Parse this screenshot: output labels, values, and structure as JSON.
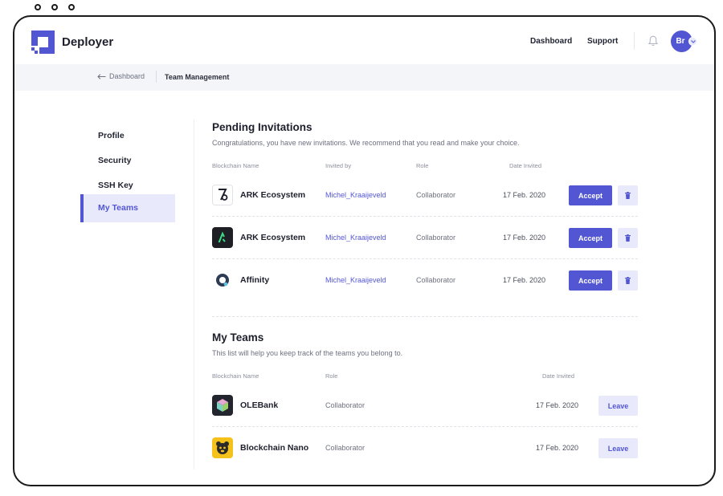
{
  "app": {
    "brand": "Deployer",
    "accent": "#5356d2"
  },
  "header": {
    "nav": [
      "Dashboard",
      "Support"
    ],
    "avatar_initials": "Br"
  },
  "breadcrumb": {
    "back_label": "Dashboard",
    "current": "Team Management"
  },
  "sidebar": {
    "items": [
      {
        "label": "Profile",
        "active": false
      },
      {
        "label": "Security",
        "active": false
      },
      {
        "label": "SSH Key",
        "active": false
      },
      {
        "label": "My Teams",
        "active": true
      }
    ]
  },
  "pending": {
    "title": "Pending Invitations",
    "subtitle": "Congratulations, you have new invitations. We recommend that you read and make your choice.",
    "columns": [
      "Blockchain Name",
      "Invited by",
      "Role",
      "Date Invited"
    ],
    "accept_label": "Accept",
    "rows": [
      {
        "name": "ARK Ecosystem",
        "icon": "ark-seven-icon",
        "invited_by": "Michel_Kraaijeveld",
        "role": "Collaborator",
        "date": "17 Feb. 2020"
      },
      {
        "name": "ARK Ecosystem",
        "icon": "ark-dark-icon",
        "invited_by": "Michel_Kraaijeveld",
        "role": "Collaborator",
        "date": "17 Feb. 2020"
      },
      {
        "name": "Affinity",
        "icon": "affinity-icon",
        "invited_by": "Michel_Kraaijeveld",
        "role": "Collaborator",
        "date": "17 Feb. 2020"
      }
    ]
  },
  "teams": {
    "title": "My Teams",
    "subtitle": "This list will help you keep track of the teams you belong to.",
    "columns": [
      "Blockchain Name",
      "Role",
      "Date Invited"
    ],
    "leave_label": "Leave",
    "rows": [
      {
        "name": "OLEBank",
        "icon": "olebank-icon",
        "role": "Collaborator",
        "date": "17 Feb. 2020"
      },
      {
        "name": "Blockchain Nano",
        "icon": "nano-bear-icon",
        "role": "Collaborator",
        "date": "17 Feb. 2020"
      }
    ]
  }
}
